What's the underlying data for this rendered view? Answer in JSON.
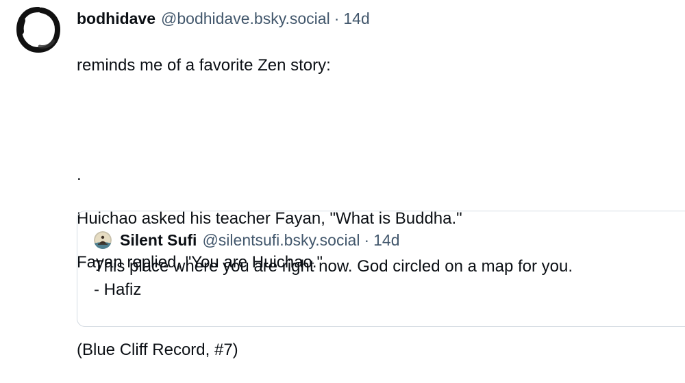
{
  "post": {
    "author": {
      "display_name": "bodhidave",
      "handle": "@bodhidave.bsky.social",
      "separator": "·",
      "timestamp": "14d",
      "avatar_icon": "enso-circle-icon"
    },
    "body_lines": [
      "reminds me of a favorite Zen story:",
      "",
      ".",
      "Huichao asked his teacher Fayan, \"What is Buddha.\"",
      "Fayan replied, \"You are Huichao.\"",
      "",
      "(Blue Cliff Record, #7)"
    ]
  },
  "quote": {
    "author": {
      "display_name": "Silent Sufi",
      "handle": "@silentsufi.bsky.social",
      "separator": "·",
      "timestamp": "14d",
      "avatar_icon": "meditating-figure-avatar-icon"
    },
    "body_lines": [
      "This place where you are right now. God circled on a map for you.",
      "- Hafiz"
    ]
  },
  "colors": {
    "text": "#0b0f14",
    "secondary": "#42576c",
    "border": "#d4dbe2"
  }
}
